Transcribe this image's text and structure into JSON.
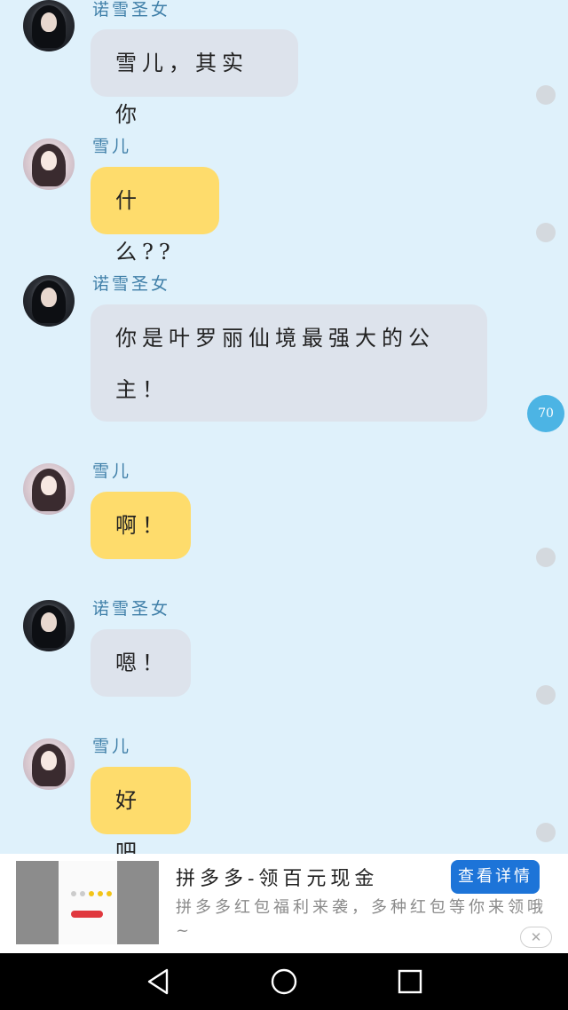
{
  "messages": [
    {
      "sender": "诺雪圣女",
      "text": "雪儿，其实你",
      "bubble_color": "#dde3ec"
    },
    {
      "sender": "雪儿",
      "text": "什么??",
      "bubble_color": "#fedc6c"
    },
    {
      "sender": "诺雪圣女",
      "text": "你是叶罗丽仙境最强大的公主！",
      "bubble_color": "#dde3ec"
    },
    {
      "sender": "雪儿",
      "text": "啊！",
      "bubble_color": "#fedc6c"
    },
    {
      "sender": "诺雪圣女",
      "text": "嗯！",
      "bubble_color": "#dde3ec"
    },
    {
      "sender": "雪儿",
      "text": "好吧",
      "bubble_color": "#fedc6c"
    }
  ],
  "badge": {
    "count": "70",
    "color": "#4cb4e4"
  },
  "ad": {
    "title": "拼多多-领百元现金",
    "description": "拼多多红包福利来袭，多种红包等你来领哦~",
    "button_label": "查看详情",
    "close_label": "✕",
    "button_color": "#1d74d8"
  },
  "navbar": {
    "icons": [
      "back-icon",
      "home-icon",
      "recent-apps-icon"
    ]
  }
}
